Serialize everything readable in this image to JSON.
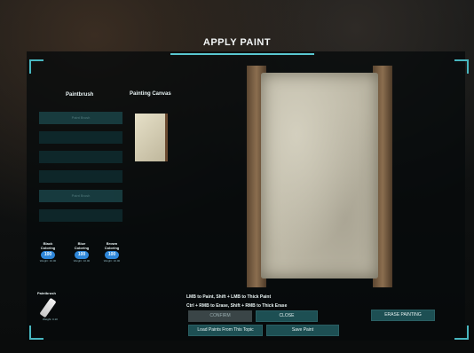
{
  "window": {
    "title": "APPLY PAINT"
  },
  "left": {
    "paintbrush_heading": "Paintbrush",
    "canvas_heading": "Painting Canvas",
    "slots": [
      {
        "label": "Paint Brush"
      },
      {
        "label": ""
      },
      {
        "label": ""
      },
      {
        "label": ""
      },
      {
        "label": "Paint Brush"
      },
      {
        "label": ""
      }
    ],
    "dyes": [
      {
        "name": "Black\nColoring",
        "amount": "100",
        "sub": "Weight: 10.00"
      },
      {
        "name": "Blue\nColoring",
        "amount": "100",
        "sub": "Weight: 10.00"
      },
      {
        "name": "Brown\nColoring",
        "amount": "100",
        "sub": "Weight: 10.00"
      }
    ],
    "paintbrush_item": {
      "name": "Paintbrush",
      "sub": "Weight: 0.10"
    }
  },
  "instructions": {
    "line1": "LMB to Paint, Shift + LMB to Thick Paint",
    "line2": "Ctrl + RMB to Erase, Shift + RMB to Thick Erase"
  },
  "buttons": {
    "confirm": "CONFIRM",
    "close": "CLOSE",
    "erase": "ERASE PAINTING",
    "load": "Load Paints From This Topic",
    "save": "Save Paint"
  },
  "colors": {
    "accent": "#48b7c0",
    "panel": "#0f2c2f"
  }
}
